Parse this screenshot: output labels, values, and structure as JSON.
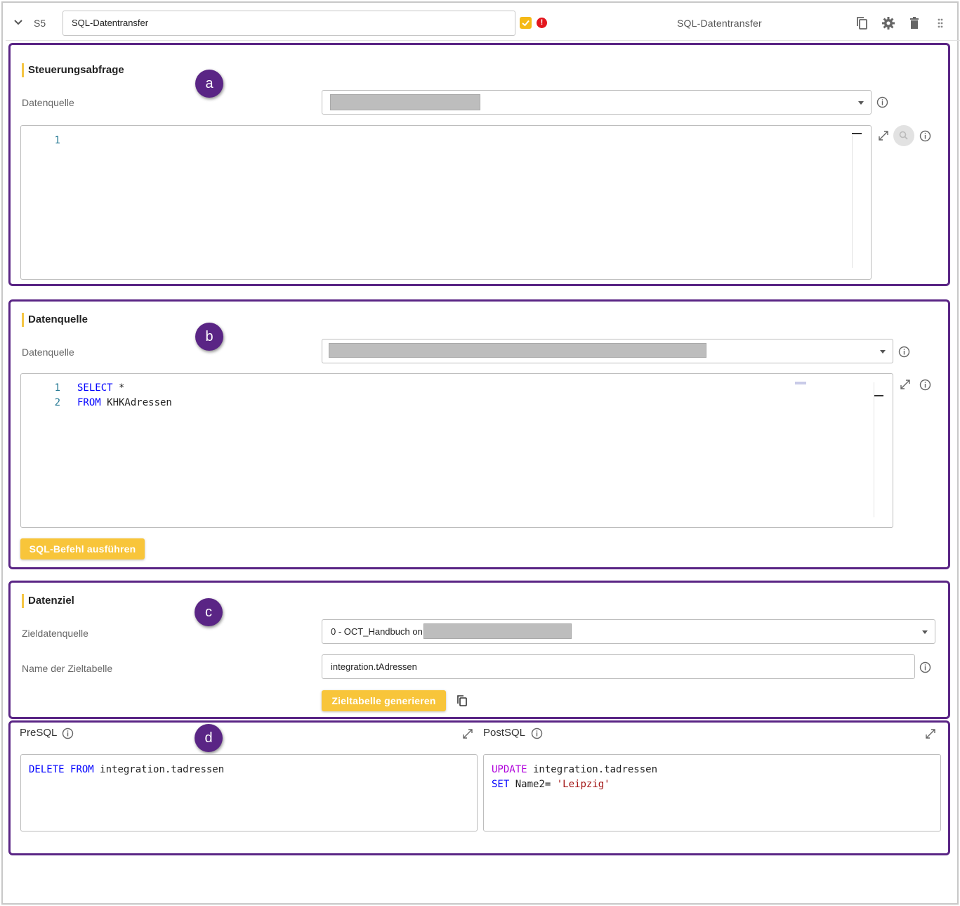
{
  "header": {
    "step": "S5",
    "title_value": "SQL-Datentransfer",
    "status_ok_icon": "check-badge-icon",
    "status_error": "!",
    "name": "SQL-Datentransfer",
    "icons": [
      "copy-icon",
      "gear-icon",
      "trash-icon",
      "drag-handle-icon"
    ]
  },
  "markers": {
    "a": "a",
    "b": "b",
    "c": "c",
    "d": "d"
  },
  "control_query": {
    "title": "Steuerungsabfrage",
    "datasource_label": "Datenquelle",
    "editor_lines": [
      "1"
    ]
  },
  "datasource": {
    "title": "Datenquelle",
    "datasource_label": "Datenquelle",
    "editor_lines": [
      "1",
      "2"
    ],
    "code": {
      "line1_kw": "SELECT",
      "line1_rest": " *",
      "line2_kw": "FROM",
      "line2_rest": " KHKAdressen"
    },
    "run_button": "SQL-Befehl ausführen"
  },
  "target": {
    "title": "Datenziel",
    "target_ds_label": "Zieldatenquelle",
    "target_ds_value": "0 - OCT_Handbuch on",
    "table_label": "Name der Zieltabelle",
    "table_value": "integration.tAdressen",
    "generate_button": "Zieltabelle generieren"
  },
  "presql": {
    "label": "PreSQL",
    "kw1": "DELETE",
    "kw2": "FROM",
    "rest": " integration.tadressen"
  },
  "postsql": {
    "label": "PostSQL",
    "kw1": "UPDATE",
    "rest1": " integration.tadressen",
    "kw2": "SET",
    "rest2": " Name2= ",
    "str": "'Leipzig'"
  },
  "colors": {
    "accent_purple": "#5a2585",
    "button_yellow": "#f8c53a",
    "error_red": "#e3171e",
    "sql_keyword": "#0000ff"
  }
}
